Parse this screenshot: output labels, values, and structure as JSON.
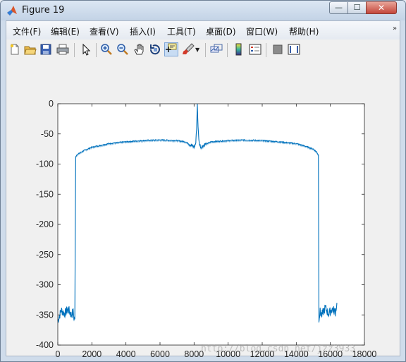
{
  "window": {
    "title": "Figure 19",
    "controls": {
      "minimize": "—",
      "maximize": "☐",
      "close": "✕"
    }
  },
  "menubar": {
    "items": [
      {
        "label": "文件(F)"
      },
      {
        "label": "编辑(E)"
      },
      {
        "label": "查看(V)"
      },
      {
        "label": "插入(I)"
      },
      {
        "label": "工具(T)"
      },
      {
        "label": "桌面(D)"
      },
      {
        "label": "窗口(W)"
      },
      {
        "label": "帮助(H)"
      }
    ],
    "overflow_icon": "double-chevron-icon"
  },
  "toolbar": {
    "buttons": [
      {
        "name": "new-figure-icon"
      },
      {
        "name": "open-file-icon"
      },
      {
        "name": "save-icon"
      },
      {
        "name": "print-icon"
      },
      {
        "name": "edit-plot-arrow-icon"
      },
      {
        "name": "zoom-in-icon"
      },
      {
        "name": "zoom-out-icon"
      },
      {
        "name": "pan-hand-icon"
      },
      {
        "name": "rotate-3d-icon"
      },
      {
        "name": "data-cursor-icon",
        "active": true
      },
      {
        "name": "brush-icon"
      },
      {
        "name": "link-plot-icon"
      },
      {
        "name": "colorbar-icon"
      },
      {
        "name": "legend-icon"
      },
      {
        "name": "hide-plot-tools-icon"
      },
      {
        "name": "show-plot-tools-icon"
      }
    ]
  },
  "chart_data": {
    "type": "line",
    "title": "",
    "xlabel": "",
    "ylabel": "",
    "xlim": [
      0,
      18000
    ],
    "ylim": [
      -400,
      0
    ],
    "xticks": [
      0,
      2000,
      4000,
      6000,
      8000,
      10000,
      12000,
      14000,
      16000,
      18000
    ],
    "xtick_labels": [
      "0",
      "2000",
      "4000",
      "6000",
      "8000",
      "10000",
      "12000",
      "14000",
      "16000",
      "18000"
    ],
    "yticks": [
      0,
      -50,
      -100,
      -150,
      -200,
      -250,
      -300,
      -350,
      -400
    ],
    "ytick_labels": [
      "0",
      "-50",
      "-100",
      "-150",
      "-200",
      "-250",
      "-300",
      "-350",
      "-400"
    ],
    "grid": false,
    "line_color": "#0072bd",
    "series": [
      {
        "x": [
          0,
          200,
          400,
          600,
          800,
          900,
          950,
          1000,
          1050,
          1100,
          1500,
          2000,
          3000,
          4000,
          5000,
          6000,
          7000,
          7500,
          7800,
          8000,
          8100,
          8150,
          8192,
          8234,
          8300,
          8400,
          8600,
          9000,
          10000,
          11000,
          12000,
          13000,
          14000,
          14500,
          15000,
          15200,
          15300,
          15330,
          15400,
          15500,
          15700,
          15900,
          16100,
          16300,
          16384
        ],
        "y": [
          -360,
          -342,
          -348,
          -340,
          -350,
          -345,
          -355,
          -355,
          -88,
          -85,
          -78,
          -72,
          -66,
          -63,
          -61,
          -60,
          -61,
          -63,
          -68,
          -72,
          -65,
          -40,
          0,
          -40,
          -65,
          -72,
          -68,
          -63,
          -61,
          -60,
          -61,
          -63,
          -66,
          -70,
          -75,
          -80,
          -85,
          -355,
          -345,
          -350,
          -338,
          -348,
          -340,
          -345,
          -330
        ]
      }
    ]
  },
  "watermark": "http://blog.csdn.net/jzz3933"
}
